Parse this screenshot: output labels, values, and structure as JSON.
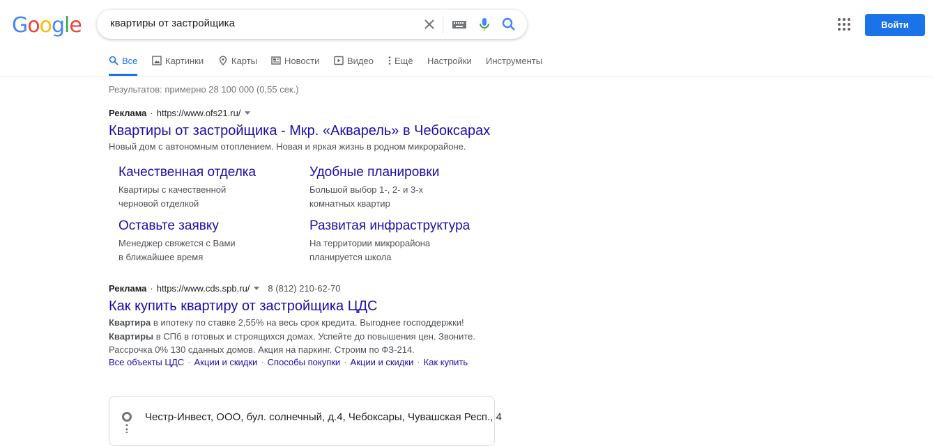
{
  "logo": {
    "letters": [
      "G",
      "o",
      "o",
      "g",
      "l",
      "e"
    ],
    "colors": [
      "#4285F4",
      "#EA4335",
      "#FBBC05",
      "#4285F4",
      "#34A853",
      "#EA4335"
    ]
  },
  "search": {
    "query": "квартиры от застройщика"
  },
  "header": {
    "signin_label": "Войти",
    "accent": "#1a73e8"
  },
  "tabs": [
    {
      "label": "Все",
      "icon": "search-icon",
      "active": true
    },
    {
      "label": "Картинки",
      "icon": "image-icon"
    },
    {
      "label": "Карты",
      "icon": "map-pin-icon"
    },
    {
      "label": "Новости",
      "icon": "news-icon"
    },
    {
      "label": "Видео",
      "icon": "video-icon"
    },
    {
      "label": "Ещё",
      "icon": "more-vert-icon"
    },
    {
      "label": "Настройки"
    },
    {
      "label": "Инструменты"
    }
  ],
  "stats": "Результатов: примерно 28 100 000 (0,55 сек.)",
  "ad1": {
    "label": "Реклама",
    "url": "https://www.ofs21.ru/",
    "title": "Квартиры от застройщика - Мкр. «Акварель» в Чебоксарах",
    "desc": "Новый дом с автономным отоплением. Новая и яркая жизнь в родном микрорайоне.",
    "sitelinks": [
      {
        "title": "Качественная отделка",
        "line1": "Квартиры с качественной",
        "line2": "черновой отделкой"
      },
      {
        "title": "Удобные планировки",
        "line1": "Большой выбор 1-, 2- и 3-х",
        "line2": "комнатных квартир"
      },
      {
        "title": "Оставьте заявку",
        "line1": "Менеджер свяжется с Вами",
        "line2": "в ближайшее время"
      },
      {
        "title": "Развитая инфраструктура",
        "line1": "На территории микрорайона",
        "line2": "планируется школа"
      }
    ]
  },
  "ad2": {
    "label": "Реклама",
    "url": "https://www.cds.spb.ru/",
    "phone": "8 (812) 210-62-70",
    "title": "Как купить квартиру от застройщика ЦДС",
    "desc1_bold": "Квартира",
    "desc1_rest": " в ипотеку по ставке 2,55% на весь срок кредита. Выгоднее господдержки!",
    "desc2_bold": "Квартиры",
    "desc2_rest": " в СПб в готовых и строящихся домах. Успейте до повышения цен. Звоните.",
    "desc3": "Рассрочка 0% 130 сданных домов. Акция на паркинг. Строим по ФЗ-214.",
    "links": [
      "Все объекты ЦДС",
      "Акции и скидки",
      "Способы покупки",
      "Акции и скидки",
      "Как купить"
    ]
  },
  "mapcard": {
    "address": "Честр-Инвест, ООО, бул. солнечный, д.4, Чебоксары, Чувашская Респ., 4"
  }
}
